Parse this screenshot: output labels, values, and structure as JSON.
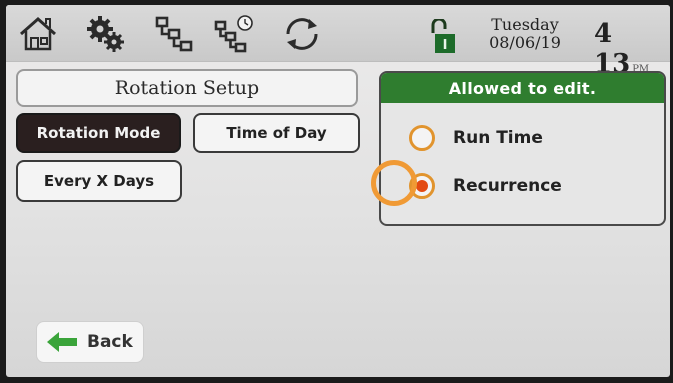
{
  "topbar": {
    "icons": [
      "home-icon",
      "settings-gears-icon",
      "network-icon",
      "network-schedule-icon",
      "sync-icon"
    ],
    "lock_icon": "unlocked-padlock-icon",
    "lock_letter": "I",
    "day": "Tuesday",
    "date": "08/06/19",
    "time": "4 13",
    "ampm": "PM"
  },
  "page": {
    "title": "Rotation Setup"
  },
  "tabs": {
    "rotation_mode": "Rotation Mode",
    "time_of_day": "Time of Day",
    "every_x_days": "Every X Days",
    "selected": "Rotation Mode"
  },
  "panel": {
    "header": "Allowed to edit.",
    "options": [
      {
        "label": "Run Time",
        "selected": false
      },
      {
        "label": "Recurrence",
        "selected": true
      }
    ]
  },
  "footer": {
    "back_label": "Back"
  },
  "colors": {
    "header_green": "#2f7d2f",
    "radio_orange": "#e1942e",
    "radio_fill": "#e34a12",
    "back_arrow": "#3aa43a"
  }
}
